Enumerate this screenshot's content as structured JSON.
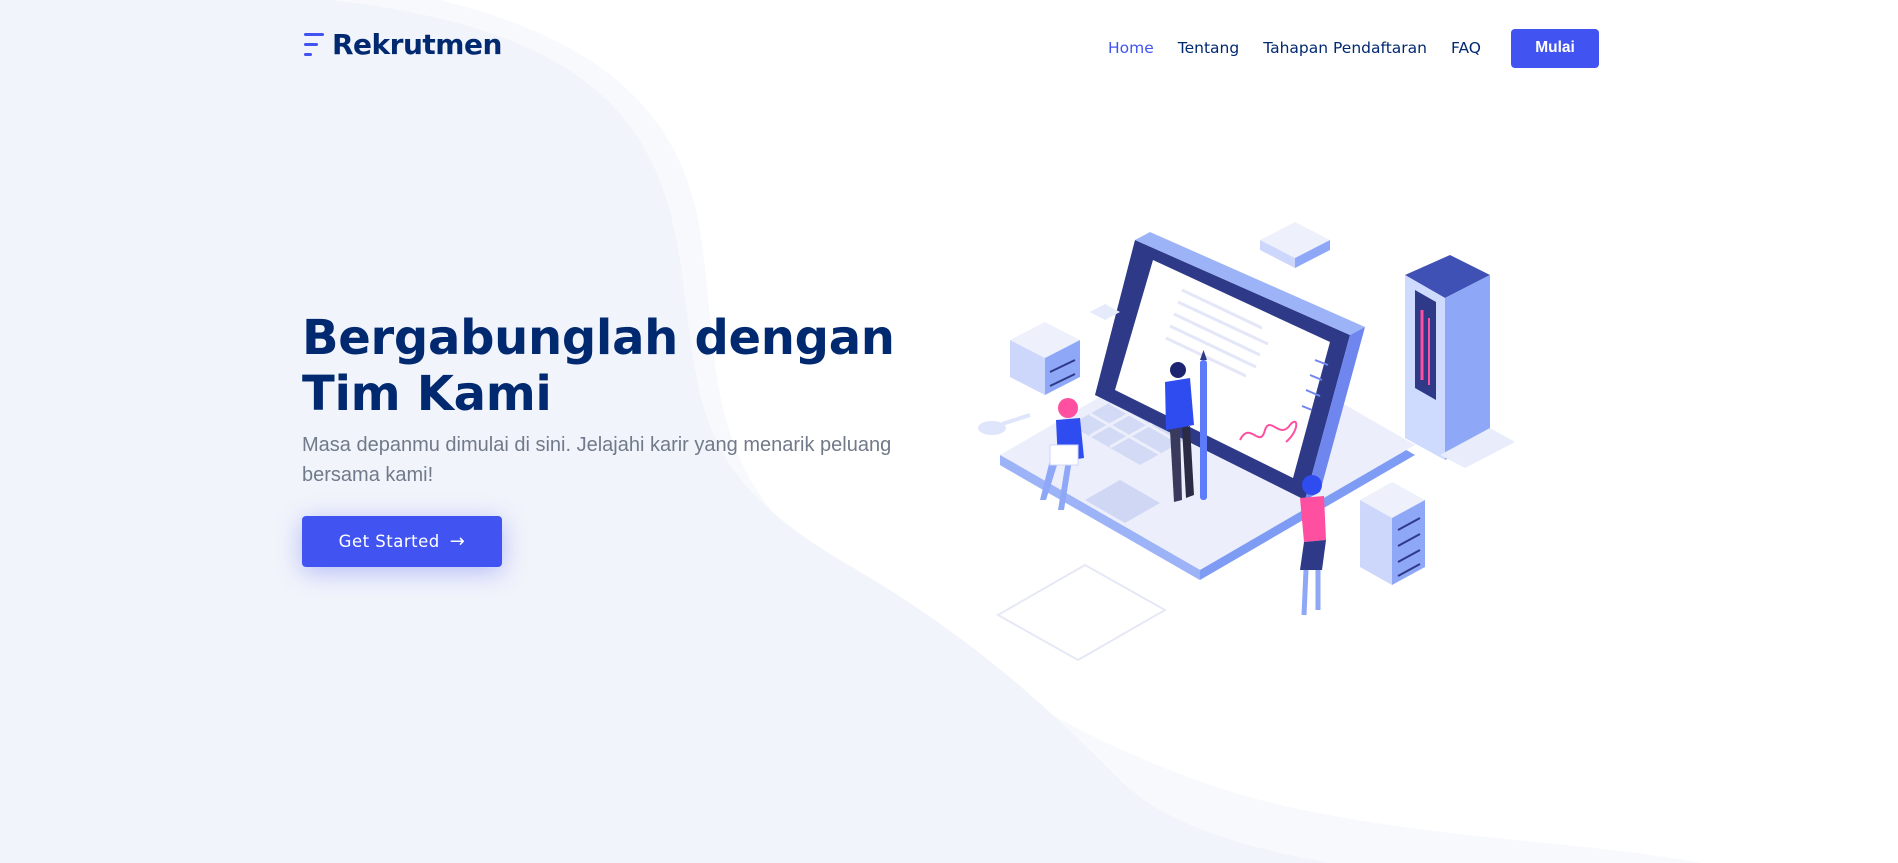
{
  "brand": {
    "name": "Rekrutmen",
    "icon": "bars-logo-icon",
    "color": "#012970"
  },
  "nav": {
    "items": [
      {
        "label": "Home",
        "active": true
      },
      {
        "label": "Tentang",
        "active": false
      },
      {
        "label": "Tahapan Pendaftaran",
        "active": false
      },
      {
        "label": "FAQ",
        "active": false
      }
    ],
    "cta_label": "Mulai"
  },
  "hero": {
    "title": "Bergabunglah dengan Tim Kami",
    "subtitle": "Masa depanmu dimulai di sini. Jelajahi karir yang menarik peluang bersama kami!",
    "button_label": "Get Started",
    "button_icon": "arrow-right-icon"
  },
  "colors": {
    "accent": "#4154f1",
    "navy": "#012970",
    "muted_text": "#717a8a",
    "background_wave": "#f2f4fb"
  },
  "illustration": {
    "icon": "isometric-laptop-team-illustration"
  }
}
